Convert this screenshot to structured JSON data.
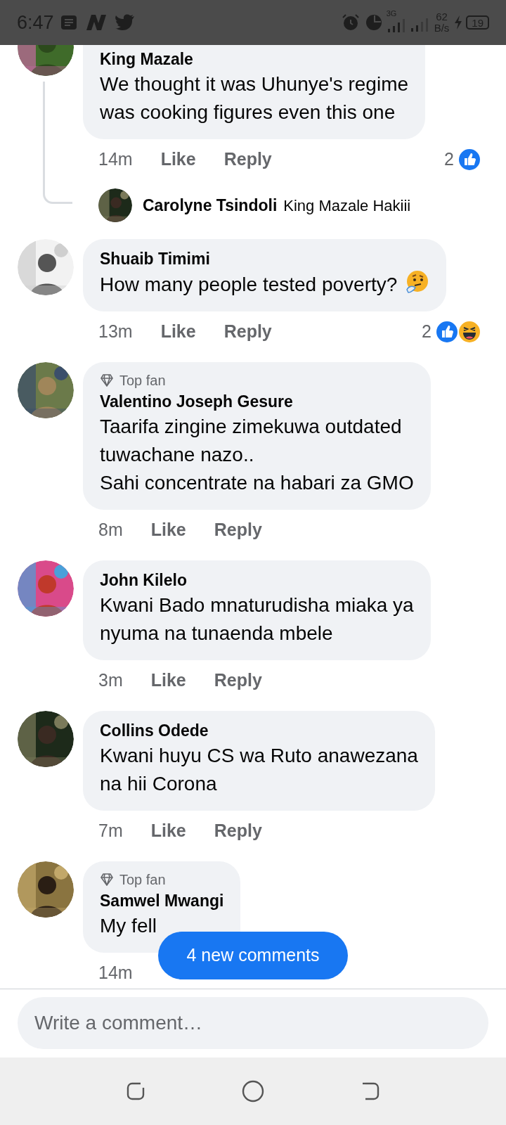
{
  "status_bar": {
    "time": "6:47",
    "network": "3G",
    "speed": "62",
    "speed_unit": "B/s",
    "battery": "19"
  },
  "comments": [
    {
      "author": "King Mazale",
      "text_lines": [
        "We thought it was Uhunye's regime",
        "was cooking figures even this one"
      ],
      "time": "14m",
      "like": "Like",
      "reply": "Reply",
      "reactions": {
        "count": "2",
        "like": true
      },
      "replies": [
        {
          "author": "Carolyne Tsindoli",
          "text": "King Mazale Hakiii"
        }
      ]
    },
    {
      "author": "Shuaib Timimi",
      "text_lines": [
        "How many people tested poverty?"
      ],
      "has_emoji": true,
      "time": "13m",
      "like": "Like",
      "reply": "Reply",
      "reactions": {
        "count": "2",
        "like": true,
        "haha": true
      }
    },
    {
      "author": "Valentino Joseph Gesure",
      "badge": "Top fan",
      "text_lines": [
        "Taarifa zingine zimekuwa outdated",
        "tuwachane nazo..",
        "Sahi concentrate na habari za GMO"
      ],
      "time": "8m",
      "like": "Like",
      "reply": "Reply"
    },
    {
      "author": "John Kilelo",
      "text_lines": [
        "Kwani Bado mnaturudisha miaka ya",
        "nyuma na tunaenda mbele"
      ],
      "time": "3m",
      "like": "Like",
      "reply": "Reply"
    },
    {
      "author": "Collins Odede",
      "text_lines": [
        "Kwani huyu CS wa Ruto anawezana",
        "na hii Corona"
      ],
      "time": "7m",
      "like": "Like",
      "reply": "Reply"
    },
    {
      "author": "Samwel Mwangi",
      "badge": "Top fan",
      "text_lines": [
        "My fell"
      ],
      "time": "14m"
    }
  ],
  "new_comments_button": "4 new comments",
  "composer": {
    "placeholder": "Write a comment…"
  }
}
